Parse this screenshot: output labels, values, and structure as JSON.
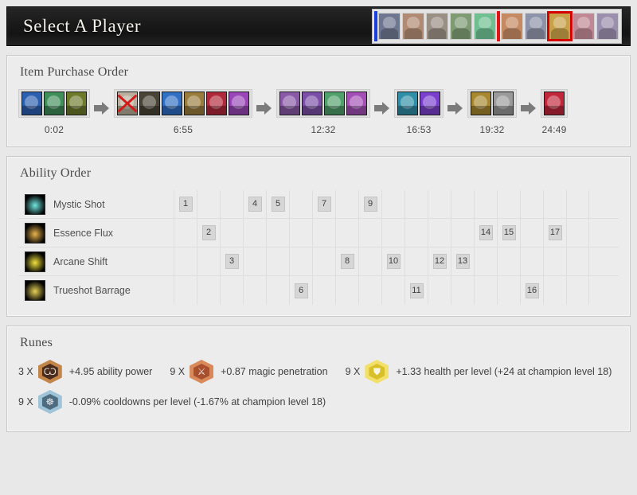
{
  "header": {
    "title": "Select A Player",
    "teams": [
      {
        "name": "blue-team",
        "side_color": "#1b3fd8",
        "champions": [
          {
            "name": "champion-portrait-1",
            "tint": "#6f7790",
            "selected": false
          },
          {
            "name": "champion-portrait-2",
            "tint": "#b08a72",
            "selected": false
          },
          {
            "name": "champion-portrait-3",
            "tint": "#9a8f84",
            "selected": false
          },
          {
            "name": "champion-portrait-4",
            "tint": "#7e9b74",
            "selected": false
          },
          {
            "name": "champion-portrait-5",
            "tint": "#6fbf91",
            "selected": false
          }
        ]
      },
      {
        "name": "red-team",
        "side_color": "#e01515",
        "champions": [
          {
            "name": "champion-portrait-6",
            "tint": "#c68a63",
            "selected": false
          },
          {
            "name": "champion-portrait-7",
            "tint": "#8d93a8",
            "selected": false
          },
          {
            "name": "champion-portrait-8",
            "tint": "#c8a24a",
            "selected": true
          },
          {
            "name": "champion-portrait-9",
            "tint": "#c08894",
            "selected": false
          },
          {
            "name": "champion-portrait-10",
            "tint": "#9b8fae",
            "selected": false
          }
        ]
      }
    ]
  },
  "item_purchase_order": {
    "title": "Item Purchase Order",
    "groups": [
      {
        "time": "0:02",
        "items": [
          {
            "name": "item-icon-doran-ring",
            "tint": "#2b5fb0",
            "sold": false
          },
          {
            "name": "item-icon-health-potion",
            "tint": "#3f8f5a",
            "sold": false
          },
          {
            "name": "item-icon-mana-potion",
            "tint": "#6d7a2a",
            "sold": false
          }
        ]
      },
      {
        "time": "6:55",
        "items": [
          {
            "name": "item-icon-sold-doran-ring",
            "tint": "#b8b09c",
            "sold": true
          },
          {
            "name": "item-icon-boots",
            "tint": "#4a4436",
            "sold": false
          },
          {
            "name": "item-icon-sapphire-crystal",
            "tint": "#2f6fc4",
            "sold": false
          },
          {
            "name": "item-icon-tome",
            "tint": "#9a7d3c",
            "sold": false
          },
          {
            "name": "item-icon-long-sword",
            "tint": "#b0293a",
            "sold": false
          },
          {
            "name": "item-icon-sheen",
            "tint": "#9a46b8",
            "sold": false
          }
        ]
      },
      {
        "time": "12:32",
        "items": [
          {
            "name": "item-icon-trinity-component",
            "tint": "#8a5aa8",
            "sold": false
          },
          {
            "name": "item-icon-eye-purple",
            "tint": "#7b4ea8",
            "sold": false
          },
          {
            "name": "item-icon-eye-green",
            "tint": "#4fa06a",
            "sold": false
          },
          {
            "name": "item-icon-sheen-2",
            "tint": "#a44fb6",
            "sold": false
          }
        ]
      },
      {
        "time": "16:53",
        "items": [
          {
            "name": "item-icon-frozen-boots",
            "tint": "#2f8fa8",
            "sold": false
          },
          {
            "name": "item-icon-lich-bane",
            "tint": "#7b3fd0",
            "sold": false
          }
        ]
      },
      {
        "time": "19:32",
        "items": [
          {
            "name": "item-icon-gold-tome",
            "tint": "#a8882e",
            "sold": false
          },
          {
            "name": "item-icon-banshees-veil",
            "tint": "#9a9a9a",
            "sold": false
          }
        ]
      },
      {
        "time": "24:49",
        "items": [
          {
            "name": "item-icon-bloodthirster",
            "tint": "#c2263a",
            "sold": false
          }
        ]
      }
    ]
  },
  "ability_order": {
    "title": "Ability Order",
    "levels": 18,
    "abilities": [
      {
        "name": "Mystic Shot",
        "icon": "ability-icon-mystic-shot",
        "tint": "#6fe6e0",
        "levels": [
          1,
          4,
          5,
          7,
          9
        ]
      },
      {
        "name": "Essence Flux",
        "icon": "ability-icon-essence-flux",
        "tint": "#e8b34a",
        "levels": [
          2,
          14,
          15,
          17
        ]
      },
      {
        "name": "Arcane Shift",
        "icon": "ability-icon-arcane-shift",
        "tint": "#f2e23a",
        "levels": [
          3,
          8,
          10,
          12,
          13
        ]
      },
      {
        "name": "Trueshot Barrage",
        "icon": "ability-icon-trueshot-barrage",
        "tint": "#e6d154",
        "levels": [
          6,
          11,
          16
        ]
      }
    ]
  },
  "runes": {
    "title": "Runes",
    "rows": [
      [
        {
          "count": "3 X",
          "icon": "rune-quintessence-ability-power",
          "color": "#4a2b1c",
          "edge": "#c2854a",
          "glyph": "Ѡ",
          "text": "+4.95 ability power"
        },
        {
          "count": "9 X",
          "icon": "rune-mark-magic-penetration",
          "color": "#a8502e",
          "edge": "#d98a5a",
          "glyph": "⚔",
          "text": "+0.87 magic penetration"
        },
        {
          "count": "9 X",
          "icon": "rune-seal-health-per-level",
          "color": "#d8c02a",
          "edge": "#f2e06a",
          "glyph": "⛊",
          "text": "+1.33 health per level (+24 at champion level 18)"
        }
      ],
      [
        {
          "count": "9 X",
          "icon": "rune-glyph-cooldowns-per-level",
          "color": "#4e6c80",
          "edge": "#9fc4d8",
          "glyph": "☸",
          "text": "-0.09% cooldowns per level (-1.67% at champion level 18)"
        }
      ]
    ]
  }
}
